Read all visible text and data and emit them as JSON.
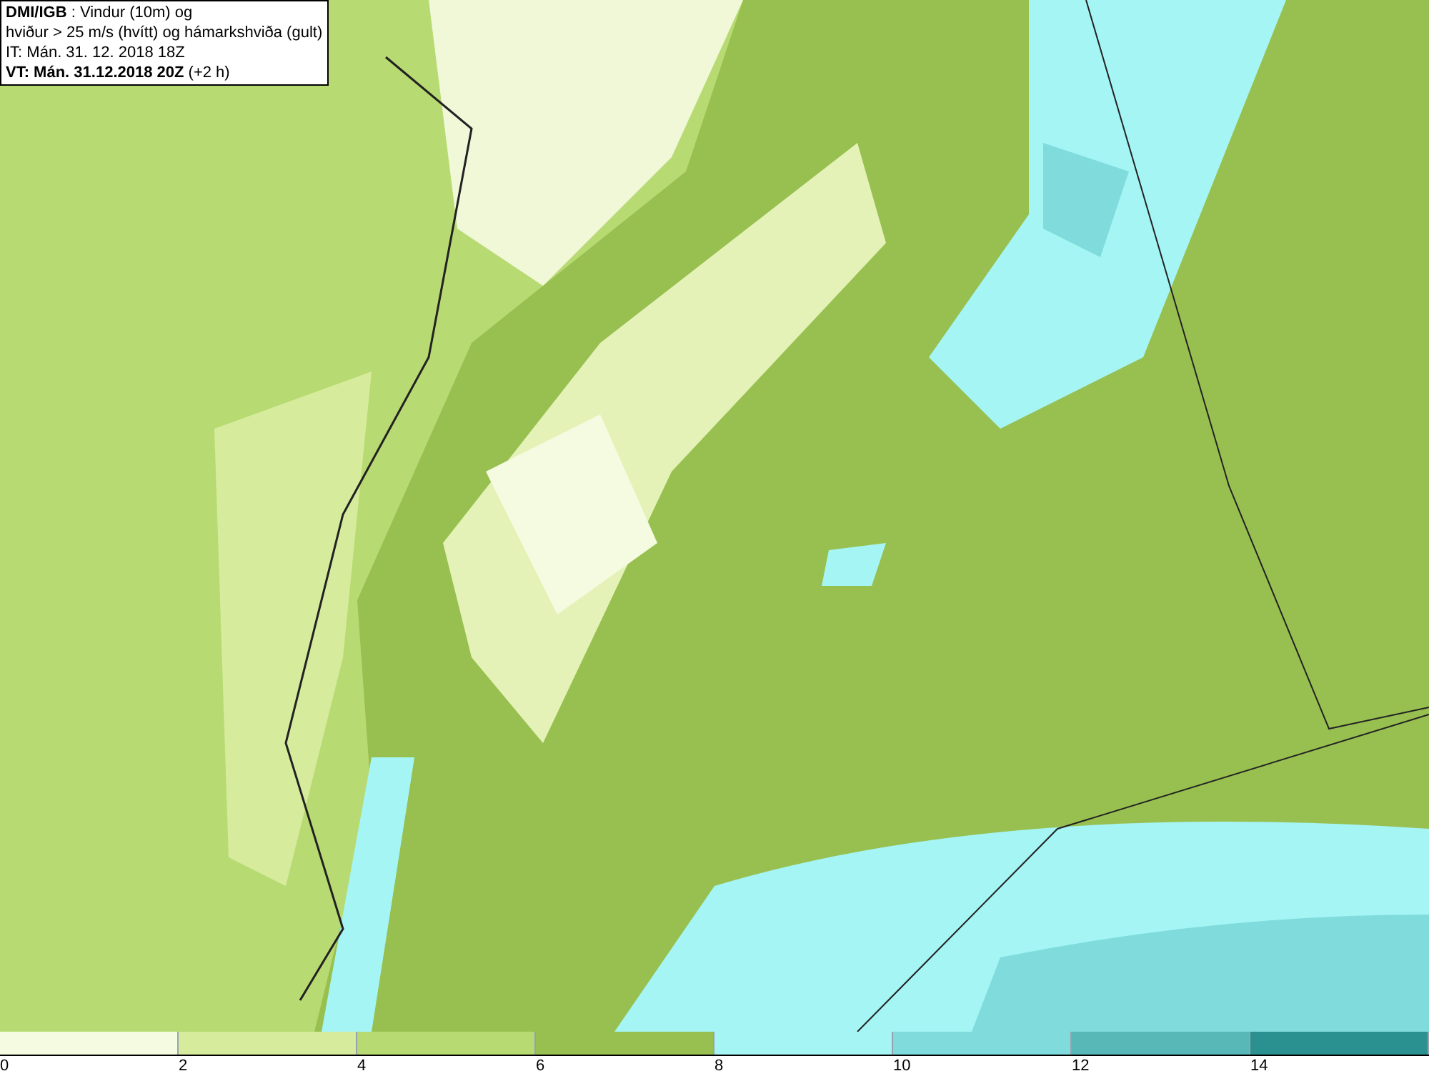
{
  "header": {
    "lines": [
      "**DMI/IGB** : Vindur (10m) og",
      "hviður > 25 m/s (hvítt) og hámarkshviða (gult)",
      "IT: Mán. 31. 12. 2018 18Z",
      "**VT: Mán. 31.12.2018 20Z** (+2 h)"
    ]
  },
  "legend": {
    "bins": [
      {
        "color": "#f5fbe0",
        "label": "0"
      },
      {
        "color": "#d6ec9c",
        "label": "2"
      },
      {
        "color": "#b8da72",
        "label": "4"
      },
      {
        "color": "#98c050",
        "label": "6"
      },
      {
        "color": "#a5f5f5",
        "label": "8"
      },
      {
        "color": "#80dcdc",
        "label": "10"
      },
      {
        "color": "#58b8b8",
        "label": "12"
      },
      {
        "color": "#2a9090",
        "label": "14"
      }
    ]
  }
}
